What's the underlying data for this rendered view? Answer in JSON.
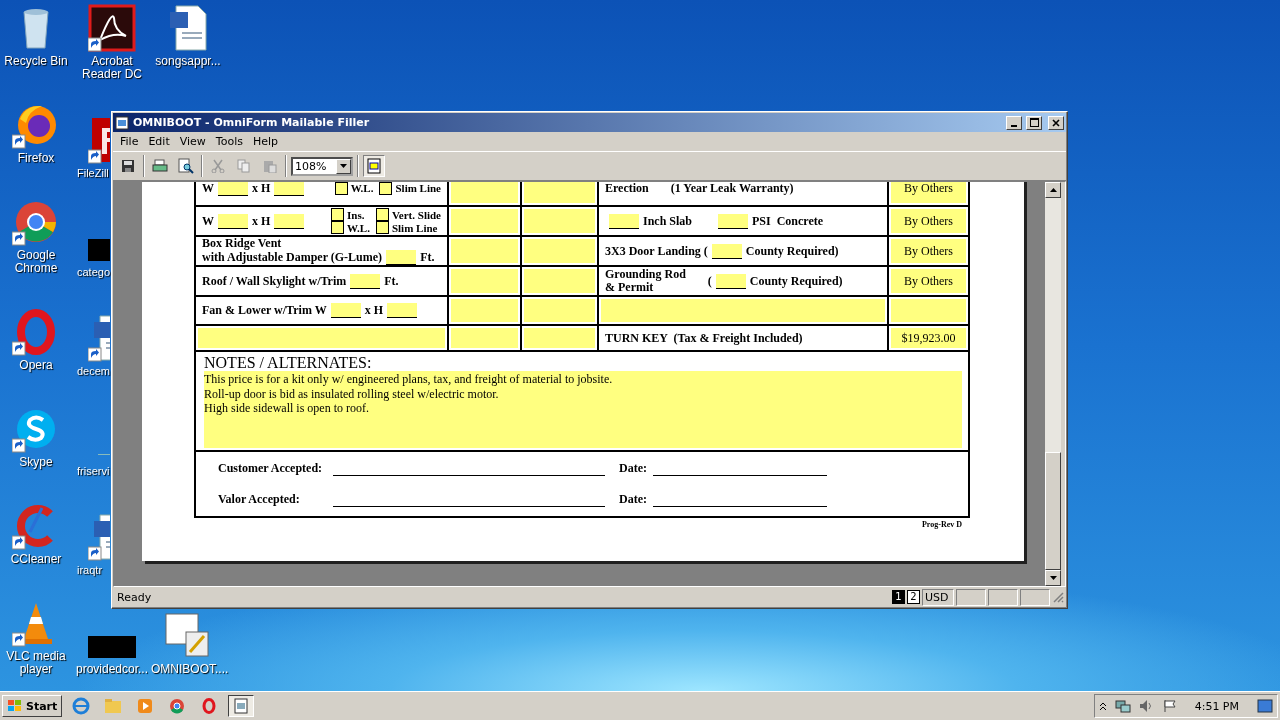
{
  "desktop": {
    "columns": [
      [
        {
          "label": "Recycle Bin",
          "kind": "bin",
          "shortcut": false,
          "covered": false
        },
        {
          "label": "Firefox",
          "kind": "firefox",
          "shortcut": true,
          "covered": false
        },
        {
          "label": "Google Chrome",
          "kind": "chrome",
          "shortcut": true,
          "covered": false
        },
        {
          "label": "Opera",
          "kind": "opera",
          "shortcut": true,
          "covered": false
        },
        {
          "label": "Skype",
          "kind": "skype",
          "shortcut": true,
          "covered": false
        },
        {
          "label": "CCleaner",
          "kind": "ccleaner",
          "shortcut": true,
          "covered": false
        },
        {
          "label": "VLC media player",
          "kind": "vlc",
          "shortcut": true,
          "covered": false
        }
      ],
      [
        {
          "label": "Acrobat Reader DC",
          "kind": "acrobat",
          "shortcut": true,
          "covered": false
        },
        {
          "label": "FileZill",
          "kind": "filezilla",
          "shortcut": true,
          "covered": true
        },
        {
          "label": "catego",
          "kind": "black",
          "shortcut": false,
          "covered": true
        },
        {
          "label": "decem",
          "kind": "word",
          "shortcut": true,
          "covered": true
        },
        {
          "label": "friservi",
          "kind": "line",
          "shortcut": false,
          "covered": true
        },
        {
          "label": "iraqtr",
          "kind": "word",
          "shortcut": true,
          "covered": true
        },
        {
          "label": "providedcor...",
          "kind": "black",
          "shortcut": false,
          "covered": false
        }
      ],
      [
        {
          "label": "songsappr...",
          "kind": "word",
          "shortcut": false,
          "covered": false
        },
        {
          "label": "OMNIBOOT....",
          "kind": "form",
          "shortcut": false,
          "covered": false
        }
      ]
    ]
  },
  "window": {
    "title": "OMNIBOOT - OmniForm Mailable Filler",
    "menu": [
      "File",
      "Edit",
      "View",
      "Tools",
      "Help"
    ],
    "toolbar": {
      "zoom": "108%",
      "form_view_on": true
    },
    "form": {
      "rows": [
        {
          "item": [
            [
              {
                "kind": "text",
                "text": "W"
              },
              {
                "kind": "blank"
              },
              {
                "kind": "text",
                "text": "x H"
              },
              {
                "kind": "blank"
              },
              {
                "kind": "options",
                "options": [
                  {
                    "label": "W.L.",
                    "checked": false
                  },
                  {
                    "label": "Slim Line",
                    "checked": false
                  }
                ]
              }
            ]
          ],
          "work": [
            [
              {
                "kind": "text",
                "text": "Erection"
              },
              {
                "kind": "gap"
              },
              {
                "kind": "text",
                "text": "(1 Year Leak Warranty)"
              }
            ]
          ],
          "price": "By Others"
        },
        {
          "item": [
            [
              {
                "kind": "text",
                "text": "W"
              },
              {
                "kind": "blank"
              },
              {
                "kind": "text",
                "text": "x H"
              },
              {
                "kind": "blank"
              },
              {
                "kind": "options",
                "options": [
                  {
                    "label": "Ins.",
                    "checked": false
                  },
                  {
                    "label": "Vert. Slide",
                    "checked": false
                  },
                  {
                    "label": "W.L.",
                    "checked": false
                  },
                  {
                    "label": "Slim Line",
                    "checked": false
                  }
                ]
              }
            ]
          ],
          "work": [
            [
              {
                "kind": "blank"
              },
              {
                "kind": "text",
                "text": "Inch Slab"
              },
              {
                "kind": "gap"
              },
              {
                "kind": "blank"
              },
              {
                "kind": "text",
                "text": "PSI  Concrete"
              }
            ]
          ],
          "price": "By Others"
        },
        {
          "item": [
            [
              {
                "kind": "text",
                "text": "Box Ridge Vent"
              }
            ],
            [
              {
                "kind": "text",
                "text": "with Adjustable Damper (G-Lume)"
              },
              {
                "kind": "blank"
              },
              {
                "kind": "text",
                "text": "Ft."
              }
            ]
          ],
          "work": [
            [
              {
                "kind": "text",
                "text": "3X3 Door Landing ("
              },
              {
                "kind": "blank"
              },
              {
                "kind": "text",
                "text": "County Required)"
              }
            ]
          ],
          "price": "By Others"
        },
        {
          "item": [
            [
              {
                "kind": "text",
                "text": "Roof / Wall Skylight w/Trim"
              },
              {
                "kind": "blank"
              },
              {
                "kind": "text",
                "text": "Ft."
              }
            ]
          ],
          "work": [
            [
              {
                "kind": "stack",
                "lines": [
                  "Grounding Rod",
                  "& Permit"
                ]
              },
              {
                "kind": "gap"
              },
              {
                "kind": "text",
                "text": "("
              },
              {
                "kind": "blank"
              },
              {
                "kind": "text",
                "text": "County Required)"
              }
            ]
          ],
          "price": "By Others"
        },
        {
          "item": [
            [
              {
                "kind": "text",
                "text": "Fan & Lower w/Trim W"
              },
              {
                "kind": "blank"
              },
              {
                "kind": "text",
                "text": "x H"
              },
              {
                "kind": "blank"
              }
            ]
          ],
          "work": [
            [
              {
                "kind": "field"
              }
            ]
          ]
        },
        {
          "item": [
            [
              {
                "kind": "field"
              }
            ]
          ],
          "work": [
            [
              {
                "kind": "text",
                "text": "TURN KEY  (Tax & Freight Included)"
              }
            ]
          ],
          "price": "$19,923.00"
        }
      ],
      "notes": {
        "heading": "NOTES / ALTERNATES:",
        "lines": [
          "This price is for a kit only w/ engineered plans, tax, and freight of material to jobsite.",
          "Roll-up door is bid as insulated rolling steel w/electric motor.",
          "High side sidewall is open to roof."
        ]
      },
      "signatures": [
        {
          "label": "Customer Accepted:",
          "date_label": "Date:"
        },
        {
          "label": "Valor Accepted:",
          "date_label": "Date:"
        }
      ],
      "footer": "Prog-Rev D"
    },
    "status_bar": {
      "text": "Ready",
      "pages": [
        {
          "label": "1",
          "selected": true
        },
        {
          "label": "2",
          "selected": false
        }
      ],
      "currency": "USD"
    }
  },
  "taskbar": {
    "start": "Start",
    "time": "4:51 PM"
  }
}
